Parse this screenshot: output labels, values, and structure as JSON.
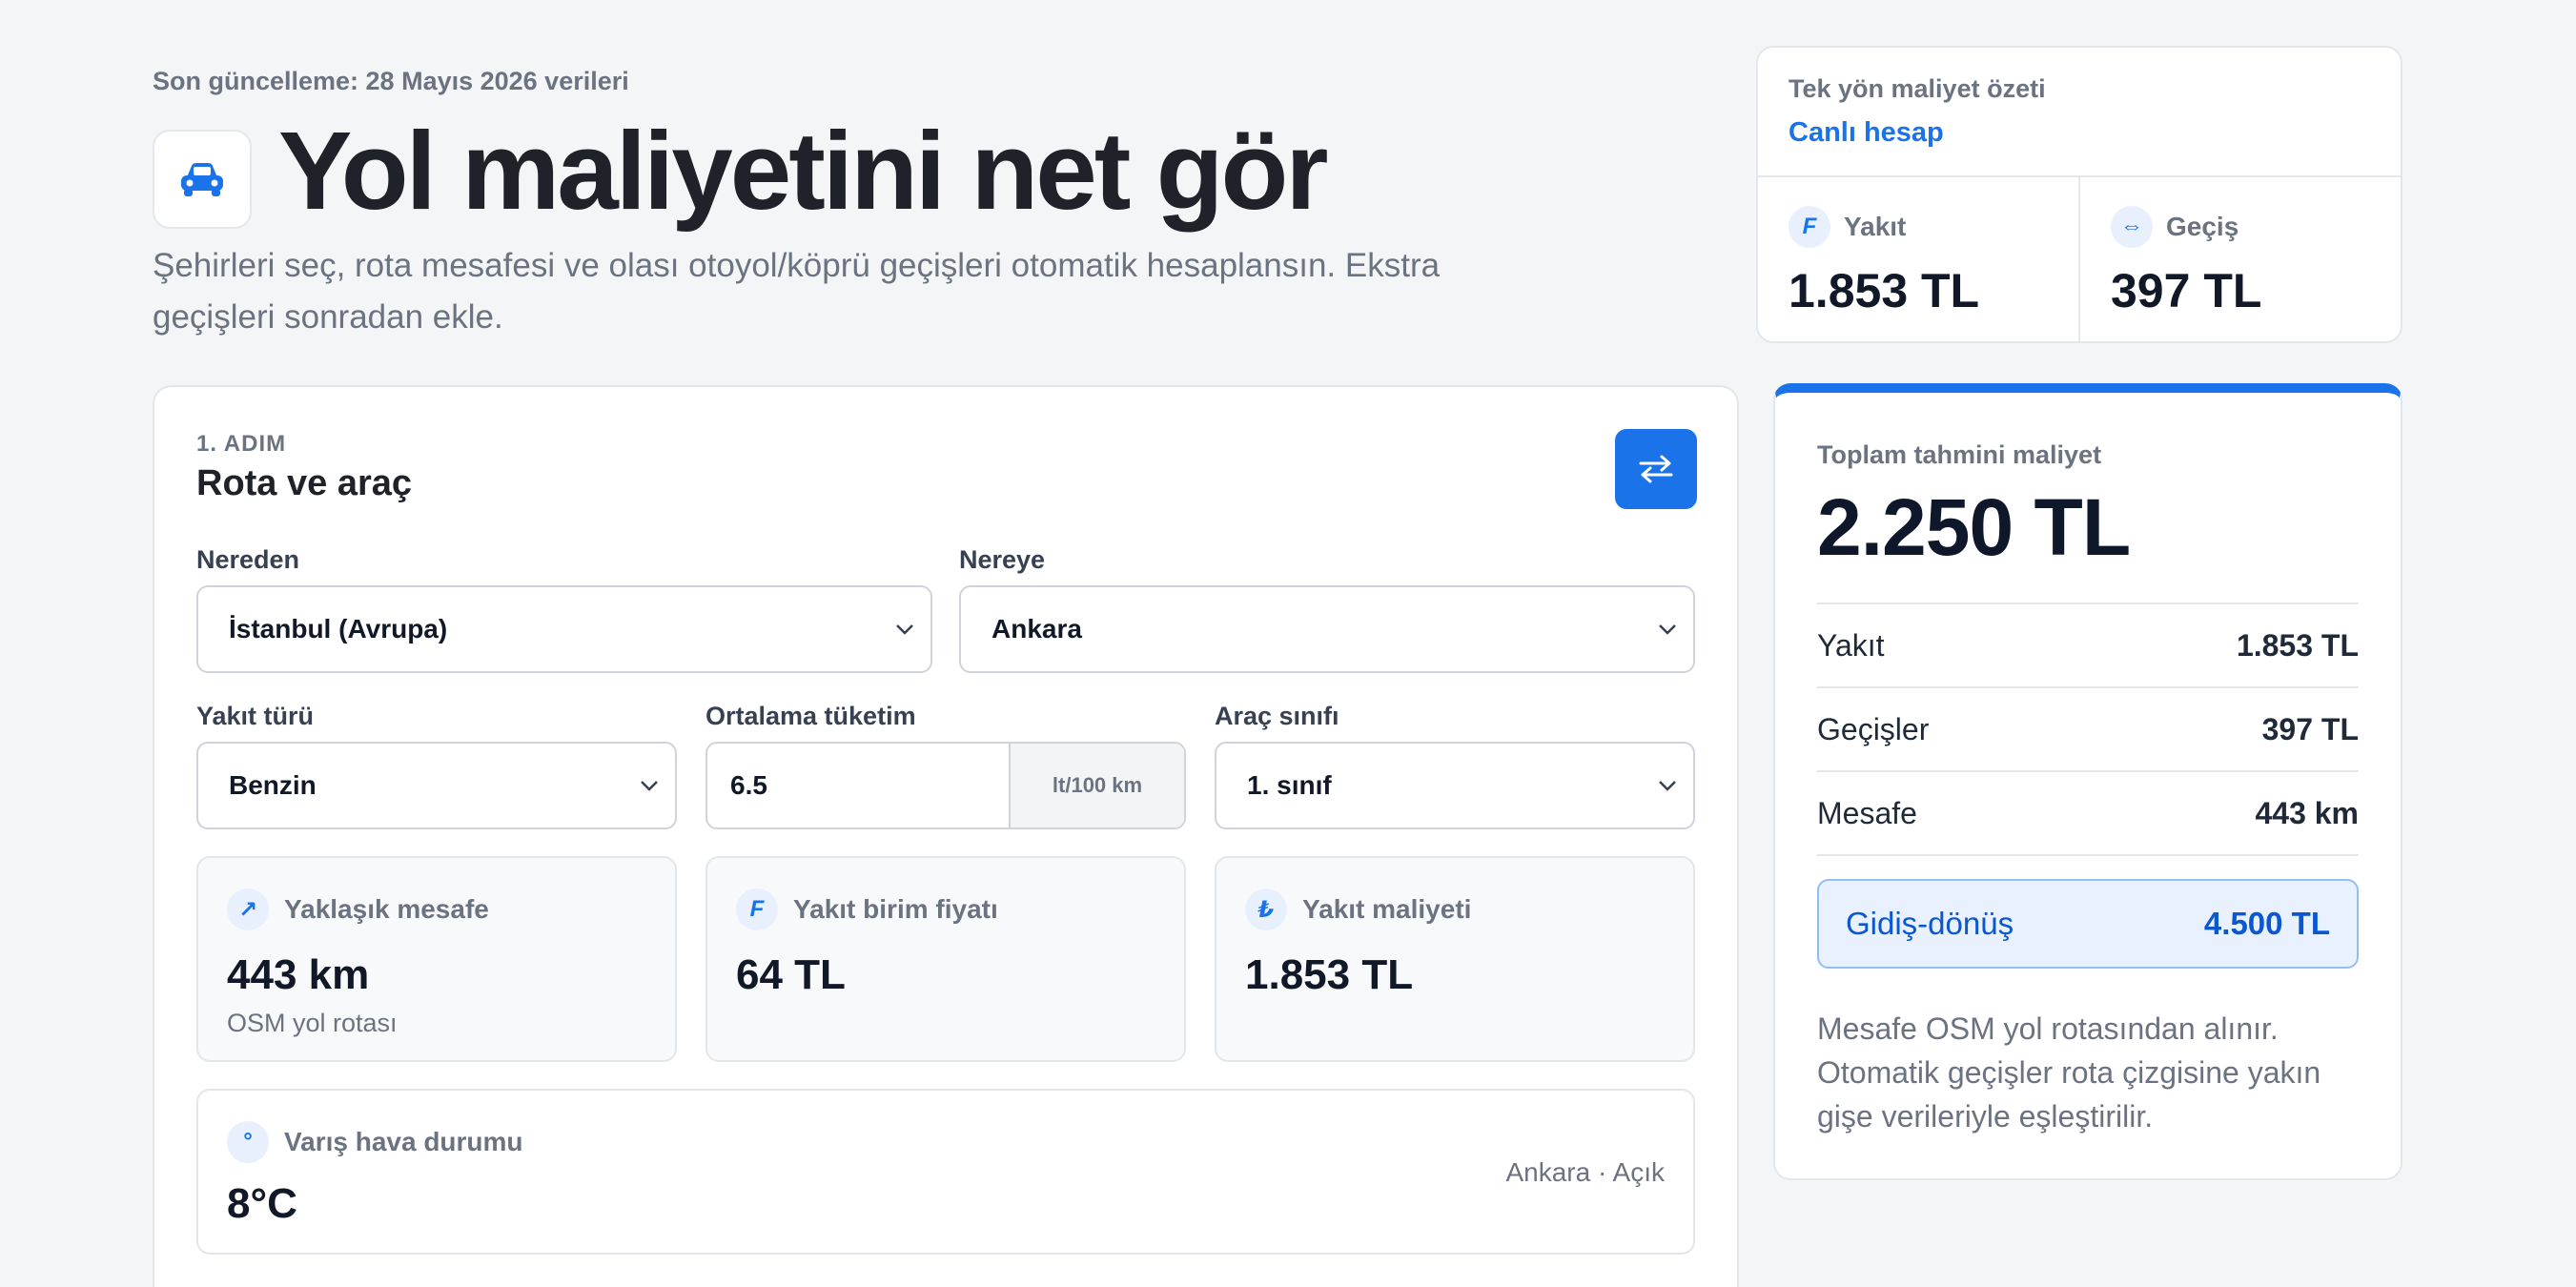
{
  "header": {
    "updated": "Son güncelleme: 28 Mayıs 2026 verileri",
    "title": "Yol maliyetini net gör",
    "subtitle": "Şehirleri seç, rota mesafesi ve olası otoyol/köprü geçişleri otomatik hesaplansın. Ekstra geçişleri sonradan ekle.",
    "icon": "car-icon"
  },
  "summary": {
    "label": "Tek yön maliyet özeti",
    "live": "Canlı hesap",
    "fuel_label": "Yakıt",
    "fuel_value": "1.853 TL",
    "fuel_icon": "F",
    "toll_label": "Geçiş",
    "toll_value": "397 TL",
    "toll_icon": "⇔"
  },
  "form": {
    "step": "1. ADIM",
    "title": "Rota ve araç",
    "from_label": "Nereden",
    "from_value": "İstanbul (Avrupa)",
    "to_label": "Nereye",
    "to_value": "Ankara",
    "fuel_type_label": "Yakıt türü",
    "fuel_type_value": "Benzin",
    "consumption_label": "Ortalama tüketim",
    "consumption_value": "6.5",
    "consumption_unit": "lt/100 km",
    "class_label": "Araç sınıfı",
    "class_value": "1. sınıf"
  },
  "info": {
    "distance_title": "Yaklaşık mesafe",
    "distance_value": "443 km",
    "distance_note": "OSM yol rotası",
    "distance_icon": "↗",
    "price_title": "Yakıt birim fiyatı",
    "price_value": "64 TL",
    "price_icon": "F",
    "cost_title": "Yakıt maliyeti",
    "cost_value": "1.853 TL",
    "cost_icon": "₺"
  },
  "weather": {
    "title": "Varış hava durumu",
    "value": "8°C",
    "right": "Ankara · Açık",
    "icon": "°"
  },
  "total": {
    "label": "Toplam tahmini maliyet",
    "value": "2.250 TL",
    "rows": [
      {
        "k": "Yakıt",
        "v": "1.853 TL"
      },
      {
        "k": "Geçişler",
        "v": "397 TL"
      },
      {
        "k": "Mesafe",
        "v": "443 km"
      }
    ],
    "roundtrip_label": "Gidiş-dönüş",
    "roundtrip_value": "4.500 TL",
    "note": "Mesafe OSM yol rotasından alınır. Otomatik geçişler rota çizgisine yakın gişe verileriyle eşleştirilir."
  },
  "colors": {
    "accent": "#1a73e8",
    "background": "#f4f5f7"
  }
}
